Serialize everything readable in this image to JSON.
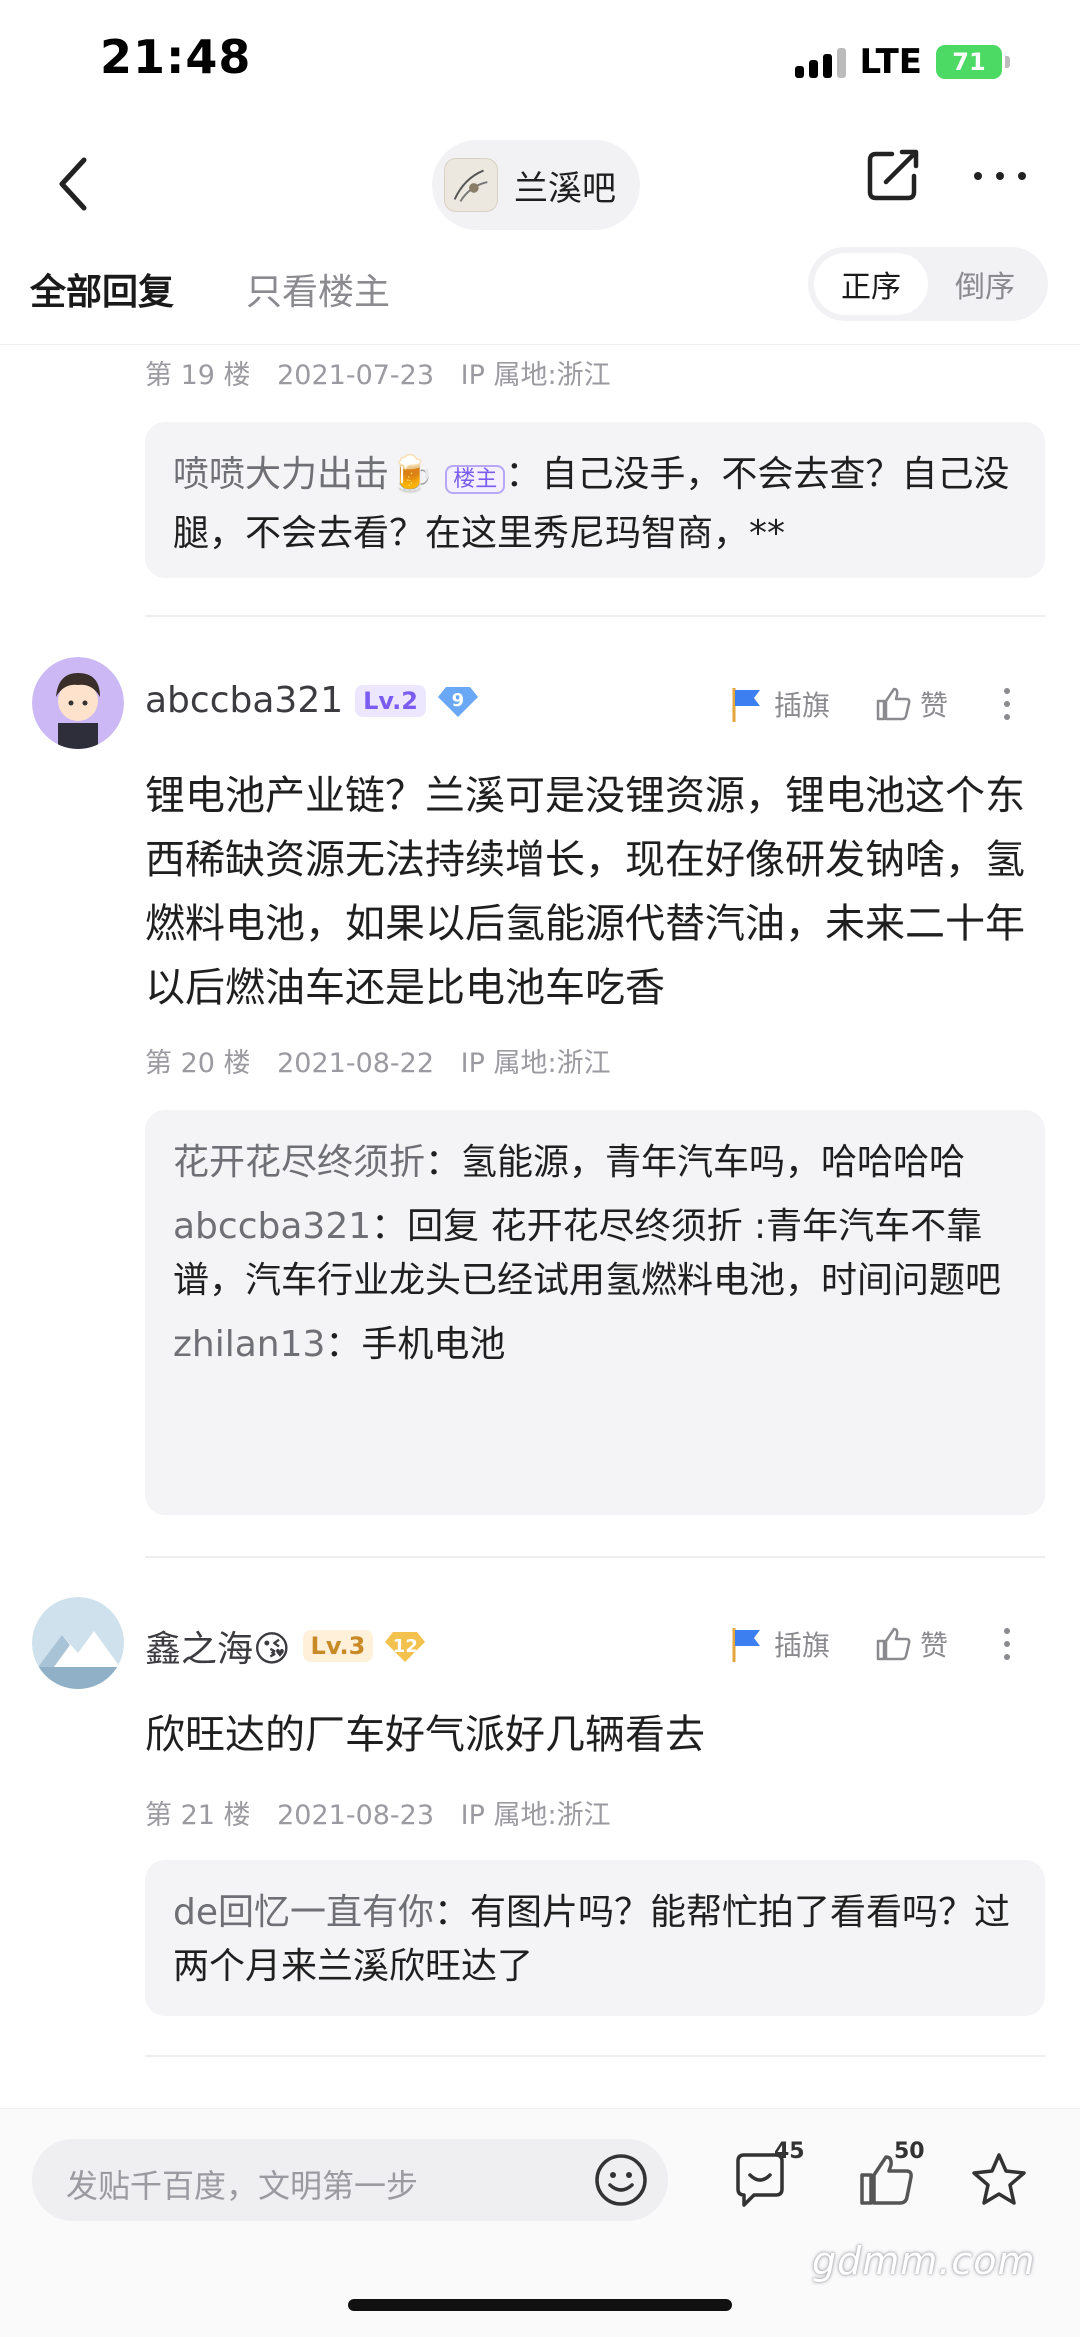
{
  "status_bar": {
    "time": "21:48",
    "network": "LTE",
    "battery": "71"
  },
  "nav": {
    "forum_name": "兰溪吧"
  },
  "tabs": {
    "all_replies": "全部回复",
    "only_op": "只看楼主"
  },
  "order": {
    "asc": "正序",
    "desc": "倒序"
  },
  "actions": {
    "flag": "插旗",
    "like": "赞"
  },
  "post19": {
    "floor": "第 19 楼",
    "date": "2021-07-23",
    "ip": "IP 属地:浙江",
    "quote_user": "喷喷大力出击",
    "quote_badge": "楼主",
    "quote_text": "自己没手，不会去查？自己没腿，不会去看？在这里秀尼玛智商，**"
  },
  "post20": {
    "username": "abccba321",
    "level": "Lv.2",
    "gem": "9",
    "body": "锂电池产业链？兰溪可是没锂资源，锂电池这个东西稀缺资源无法持续增长，现在好像研发钠啥，氢燃料电池，如果以后氢能源代替汽油，未来二十年以后燃油车还是比电池车吃香",
    "floor": "第 20 楼",
    "date": "2021-08-22",
    "ip": "IP 属地:浙江",
    "replies": [
      {
        "user": "花开花尽终须折",
        "text": "氢能源，青年汽车吗，哈哈哈哈"
      },
      {
        "user": "abccba321",
        "text": "回复 花开花尽终须折 :青年汽车不靠谱，汽车行业龙头已经试用氢燃料电池，时间问题吧"
      },
      {
        "user": "zhilan13",
        "text": "手机电池"
      }
    ]
  },
  "post21": {
    "username": "鑫之海😘",
    "level": "Lv.3",
    "gem": "12",
    "body": "欣旺达的厂车好气派好几辆看去",
    "floor": "第 21 楼",
    "date": "2021-08-23",
    "ip": "IP 属地:浙江",
    "replies": [
      {
        "user": "de回忆一直有你",
        "text": "有图片吗？能帮忙拍了看看吗？过两个月来兰溪欣旺达了"
      }
    ]
  },
  "bottom": {
    "placeholder": "发贴千百度，文明第一步",
    "comment_count": "45",
    "like_count": "50"
  },
  "watermark": "gdmm.com",
  "colors": {
    "accent_purple": "#7b5cf0",
    "flag_blue": "#3c7ff0",
    "battery_green": "#4cd964"
  }
}
